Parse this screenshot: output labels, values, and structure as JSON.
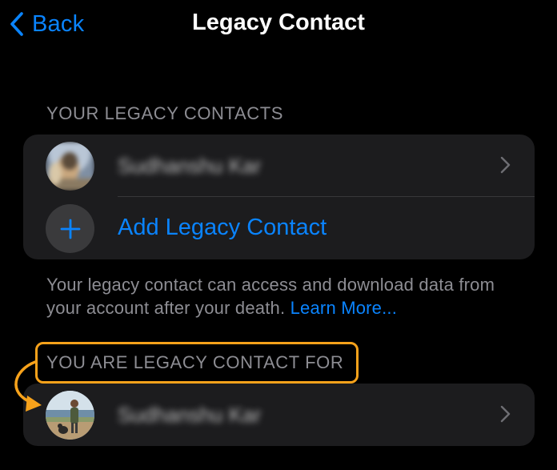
{
  "nav": {
    "back_label": "Back",
    "title": "Legacy Contact"
  },
  "legacy_contacts": {
    "header": "YOUR LEGACY CONTACTS",
    "contact_name": "Sudhanshu Kar",
    "add_label": "Add Legacy Contact"
  },
  "footer": {
    "text": "Your legacy contact can access and download data from your account after your death.",
    "link": "Learn More..."
  },
  "legacy_for": {
    "header": "YOU ARE LEGACY CONTACT FOR",
    "contact_name": "Sudhanshu Kar"
  },
  "colors": {
    "accent": "#0a84ff",
    "highlight": "#f7a21b",
    "background": "#000000",
    "group_background": "#1c1c1e"
  },
  "icons": [
    "chevron-left-icon",
    "plus-icon",
    "chevron-right-icon",
    "curved-arrow-icon"
  ]
}
